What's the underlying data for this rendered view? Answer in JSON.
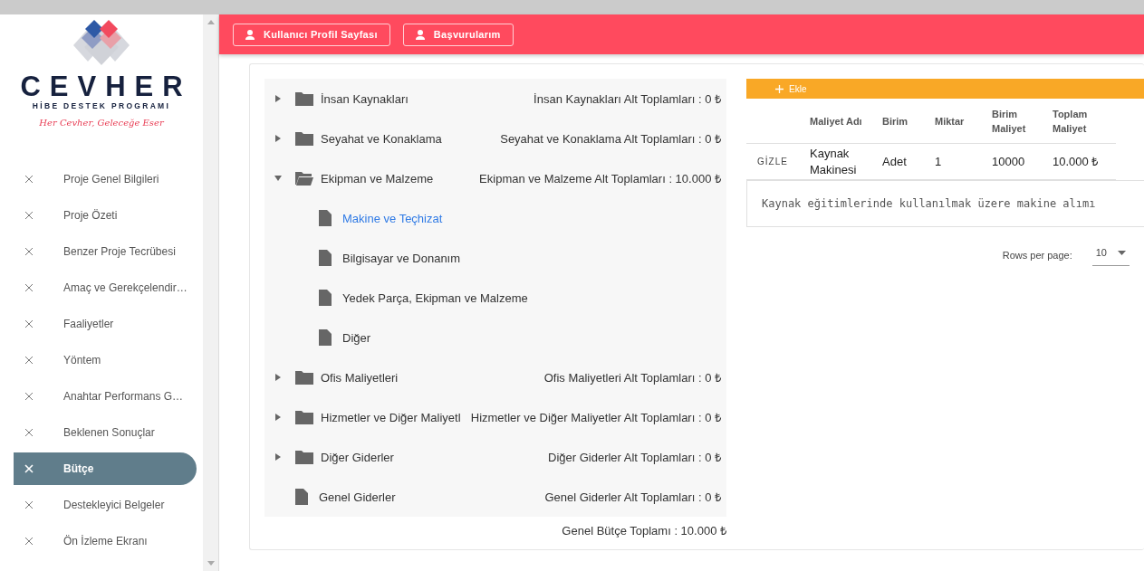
{
  "logo": {
    "title": "CEVHER",
    "subtitle": "HİBE DESTEK PROGRAMI",
    "slogan": "Her Cevher, Geleceğe Eser"
  },
  "sidebar": {
    "items": [
      {
        "label": "Proje Genel Bilgileri",
        "selected": false
      },
      {
        "label": "Proje Özeti",
        "selected": false
      },
      {
        "label": "Benzer Proje Tecrübesi",
        "selected": false
      },
      {
        "label": "Amaç ve Gerekçelendir…",
        "selected": false
      },
      {
        "label": "Faaliyetler",
        "selected": false
      },
      {
        "label": "Yöntem",
        "selected": false
      },
      {
        "label": "Anahtar Performans G…",
        "selected": false
      },
      {
        "label": "Beklenen Sonuçlar",
        "selected": false
      },
      {
        "label": "Bütçe",
        "selected": true
      },
      {
        "label": "Destekleyici Belgeler",
        "selected": false
      },
      {
        "label": "Ön İzleme Ekranı",
        "selected": false
      }
    ]
  },
  "header": {
    "buttons": [
      "Kullanıcı Profil Sayfası",
      "Başvurularım"
    ]
  },
  "tree": {
    "items": [
      {
        "kind": "folder",
        "label": "İnsan Kaynakları",
        "subtotal": "İnsan Kaynakları Alt Toplamları : 0 ₺",
        "expanded": false
      },
      {
        "kind": "folder",
        "label": "Seyahat ve Konaklama",
        "subtotal": "Seyahat ve Konaklama Alt Toplamları : 0 ₺",
        "expanded": false
      },
      {
        "kind": "folder",
        "label": "Ekipman ve Malzeme",
        "subtotal": "Ekipman ve Malzeme Alt Toplamları : 10.000 ₺",
        "expanded": true,
        "children": [
          {
            "kind": "file",
            "label": "Makine ve Teçhizat",
            "selected": true
          },
          {
            "kind": "file",
            "label": "Bilgisayar ve Donanım",
            "selected": false
          },
          {
            "kind": "file",
            "label": "Yedek Parça, Ekipman ve Malzeme",
            "selected": false
          },
          {
            "kind": "file",
            "label": "Diğer",
            "selected": false
          }
        ]
      },
      {
        "kind": "folder",
        "label": "Ofis Maliyetleri",
        "subtotal": "Ofis Maliyetleri Alt Toplamları : 0 ₺",
        "expanded": false
      },
      {
        "kind": "folder",
        "label": "Hizmetler ve Diğer Maliyetl",
        "subtotal": "Hizmetler ve Diğer Maliyetler Alt Toplamları : 0 ₺",
        "expanded": false
      },
      {
        "kind": "folder",
        "label": "Diğer Giderler",
        "subtotal": "Diğer Giderler Alt Toplamları : 0 ₺",
        "expanded": false
      },
      {
        "kind": "file",
        "label": "Genel Giderler",
        "subtotal": "Genel Giderler Alt Toplamları : 0 ₺"
      }
    ],
    "total": "Genel Bütçe Toplamı : 10.000 ₺"
  },
  "table": {
    "add_button": "Ekle",
    "columns": [
      "",
      "Maliyet Adı",
      "Birim",
      "Miktar",
      "Birim Maliyet",
      "Toplam Maliyet"
    ],
    "rows": [
      {
        "cells": [
          "GİZLE",
          "Kaynak Makinesi",
          "Adet",
          "1",
          "10000",
          "10.000 ₺"
        ],
        "detail": "Kaynak eğitimlerinde kullanılmak üzere makine alımı"
      }
    ],
    "rows_per_page_label": "Rows per page:",
    "rows_per_page": "10"
  }
}
